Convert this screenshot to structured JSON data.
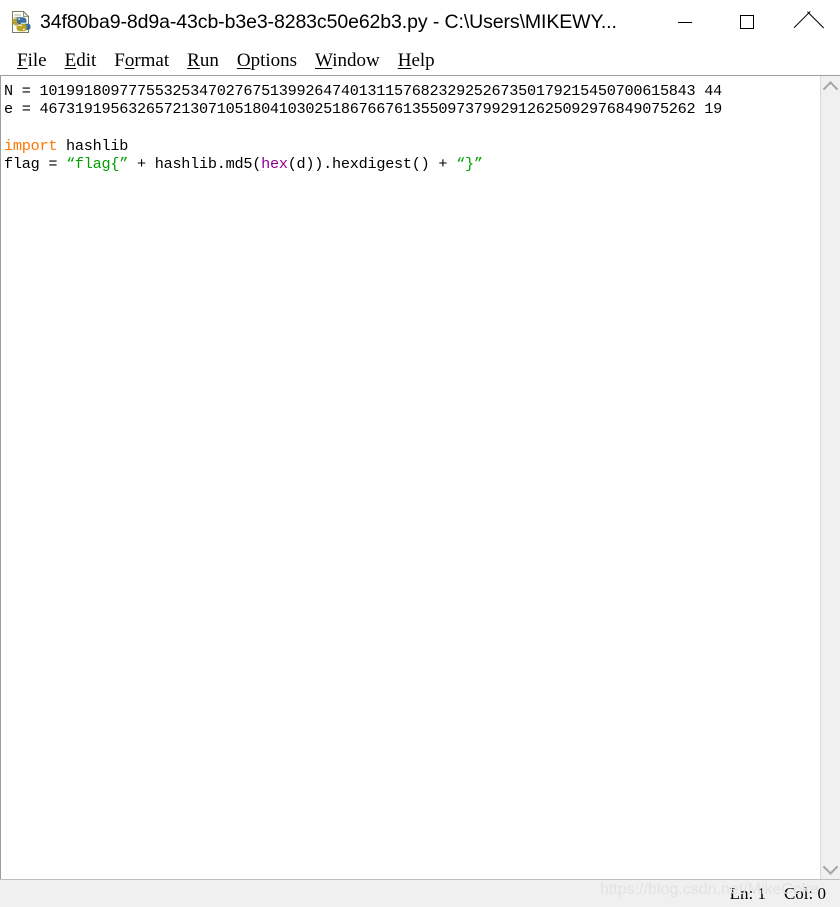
{
  "window": {
    "title": "34f80ba9-8d9a-43cb-b3e3-8283c50e62b3.py - C:\\Users\\MIKEWY...",
    "icon": "python-file-icon",
    "controls": {
      "minimize": "minimize-button",
      "maximize": "maximize-button",
      "close": "close-button"
    }
  },
  "menubar": {
    "items": [
      {
        "label": "File",
        "mnemonic": "F",
        "rest": "ile"
      },
      {
        "label": "Edit",
        "mnemonic": "E",
        "rest": "dit"
      },
      {
        "label": "Format",
        "pre": "F",
        "mnemonic": "o",
        "rest": "rmat"
      },
      {
        "label": "Run",
        "mnemonic": "R",
        "rest": "un"
      },
      {
        "label": "Options",
        "mnemonic": "O",
        "rest": "ptions"
      },
      {
        "label": "Window",
        "mnemonic": "W",
        "rest": "indow"
      },
      {
        "label": "Help",
        "mnemonic": "H",
        "rest": "elp"
      }
    ]
  },
  "editor": {
    "lines": {
      "l1_prefix": "N = ",
      "l1_value": "10199180977755325347027675139926474013115768232925267350179215450700615843 44",
      "l2_prefix": "e = ",
      "l2_value": "46731919563265721307105180410302518676676135509737992912625092976849075262 19",
      "l4_kw": "import",
      "l4_mod": " hashlib",
      "l5_a": "flag = ",
      "l5_str1": "“flag{”",
      "l5_b": " + hashlib.md5(",
      "l5_bi": "hex",
      "l5_c": "(d)).hexdigest() + ",
      "l5_str2": "“}”"
    }
  },
  "scrollbar": {
    "up_arrow": "scroll-up-arrow",
    "down_arrow": "scroll-down-arrow"
  },
  "statusbar": {
    "line_label": "Ln: 1",
    "col_label": "Col: 0"
  },
  "watermark": {
    "text": "https://blog.csdn.net/MikeCoke"
  },
  "colors": {
    "keyword": "#ff7700",
    "string": "#00a000",
    "builtin": "#900090",
    "chrome": "#f0f0f0"
  }
}
